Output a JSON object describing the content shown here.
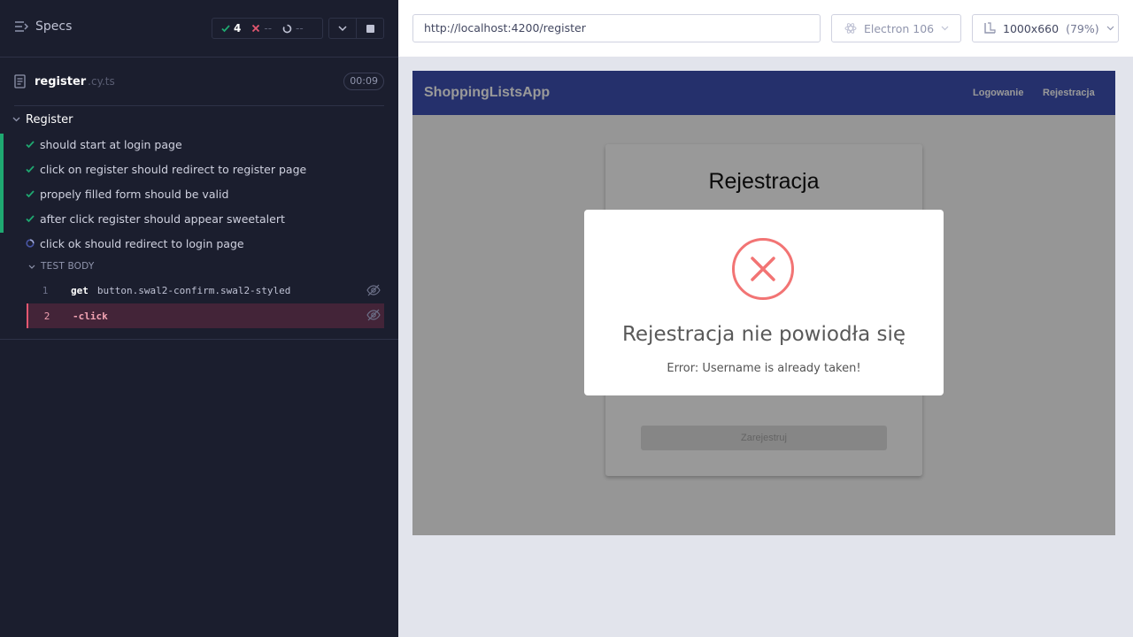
{
  "reporter": {
    "specs_label": "Specs",
    "stats": {
      "passed": "4",
      "failed": "--",
      "pending": "--"
    },
    "file": {
      "name": "register",
      "ext": ".cy.ts",
      "duration": "00:09"
    },
    "suite": "Register",
    "tests": [
      {
        "title": "should start at login page",
        "state": "passed"
      },
      {
        "title": "click on register should redirect to register page",
        "state": "passed"
      },
      {
        "title": "propely filled form should be valid",
        "state": "passed"
      },
      {
        "title": "after click register should appear sweetalert",
        "state": "passed"
      },
      {
        "title": "click ok should redirect to login page",
        "state": "running"
      }
    ],
    "test_body_label": "TEST BODY",
    "commands": [
      {
        "num": "1",
        "name": "get",
        "message": "button.swal2-confirm.swal2-styled"
      },
      {
        "num": "2",
        "name": "-click",
        "message": ""
      }
    ]
  },
  "topbar": {
    "url": "http://localhost:4200/register",
    "browser": "Electron 106",
    "viewport": "1000x660",
    "scale": "(79%)"
  },
  "app": {
    "brand": "ShoppingListsApp",
    "nav": {
      "login": "Logowanie",
      "register": "Rejestracja"
    },
    "card_title": "Rejestracja",
    "register_button": "Zarejestruj"
  },
  "modal": {
    "title": "Rejestracja nie powiodła się",
    "text": "Error: Username is already taken!",
    "icon": "error-x-icon"
  },
  "colors": {
    "reporter_bg": "#1b1e2e",
    "pass": "#1fa971",
    "fail": "#e45770",
    "navbar": "#3f51b5",
    "error_icon": "#f27474"
  }
}
